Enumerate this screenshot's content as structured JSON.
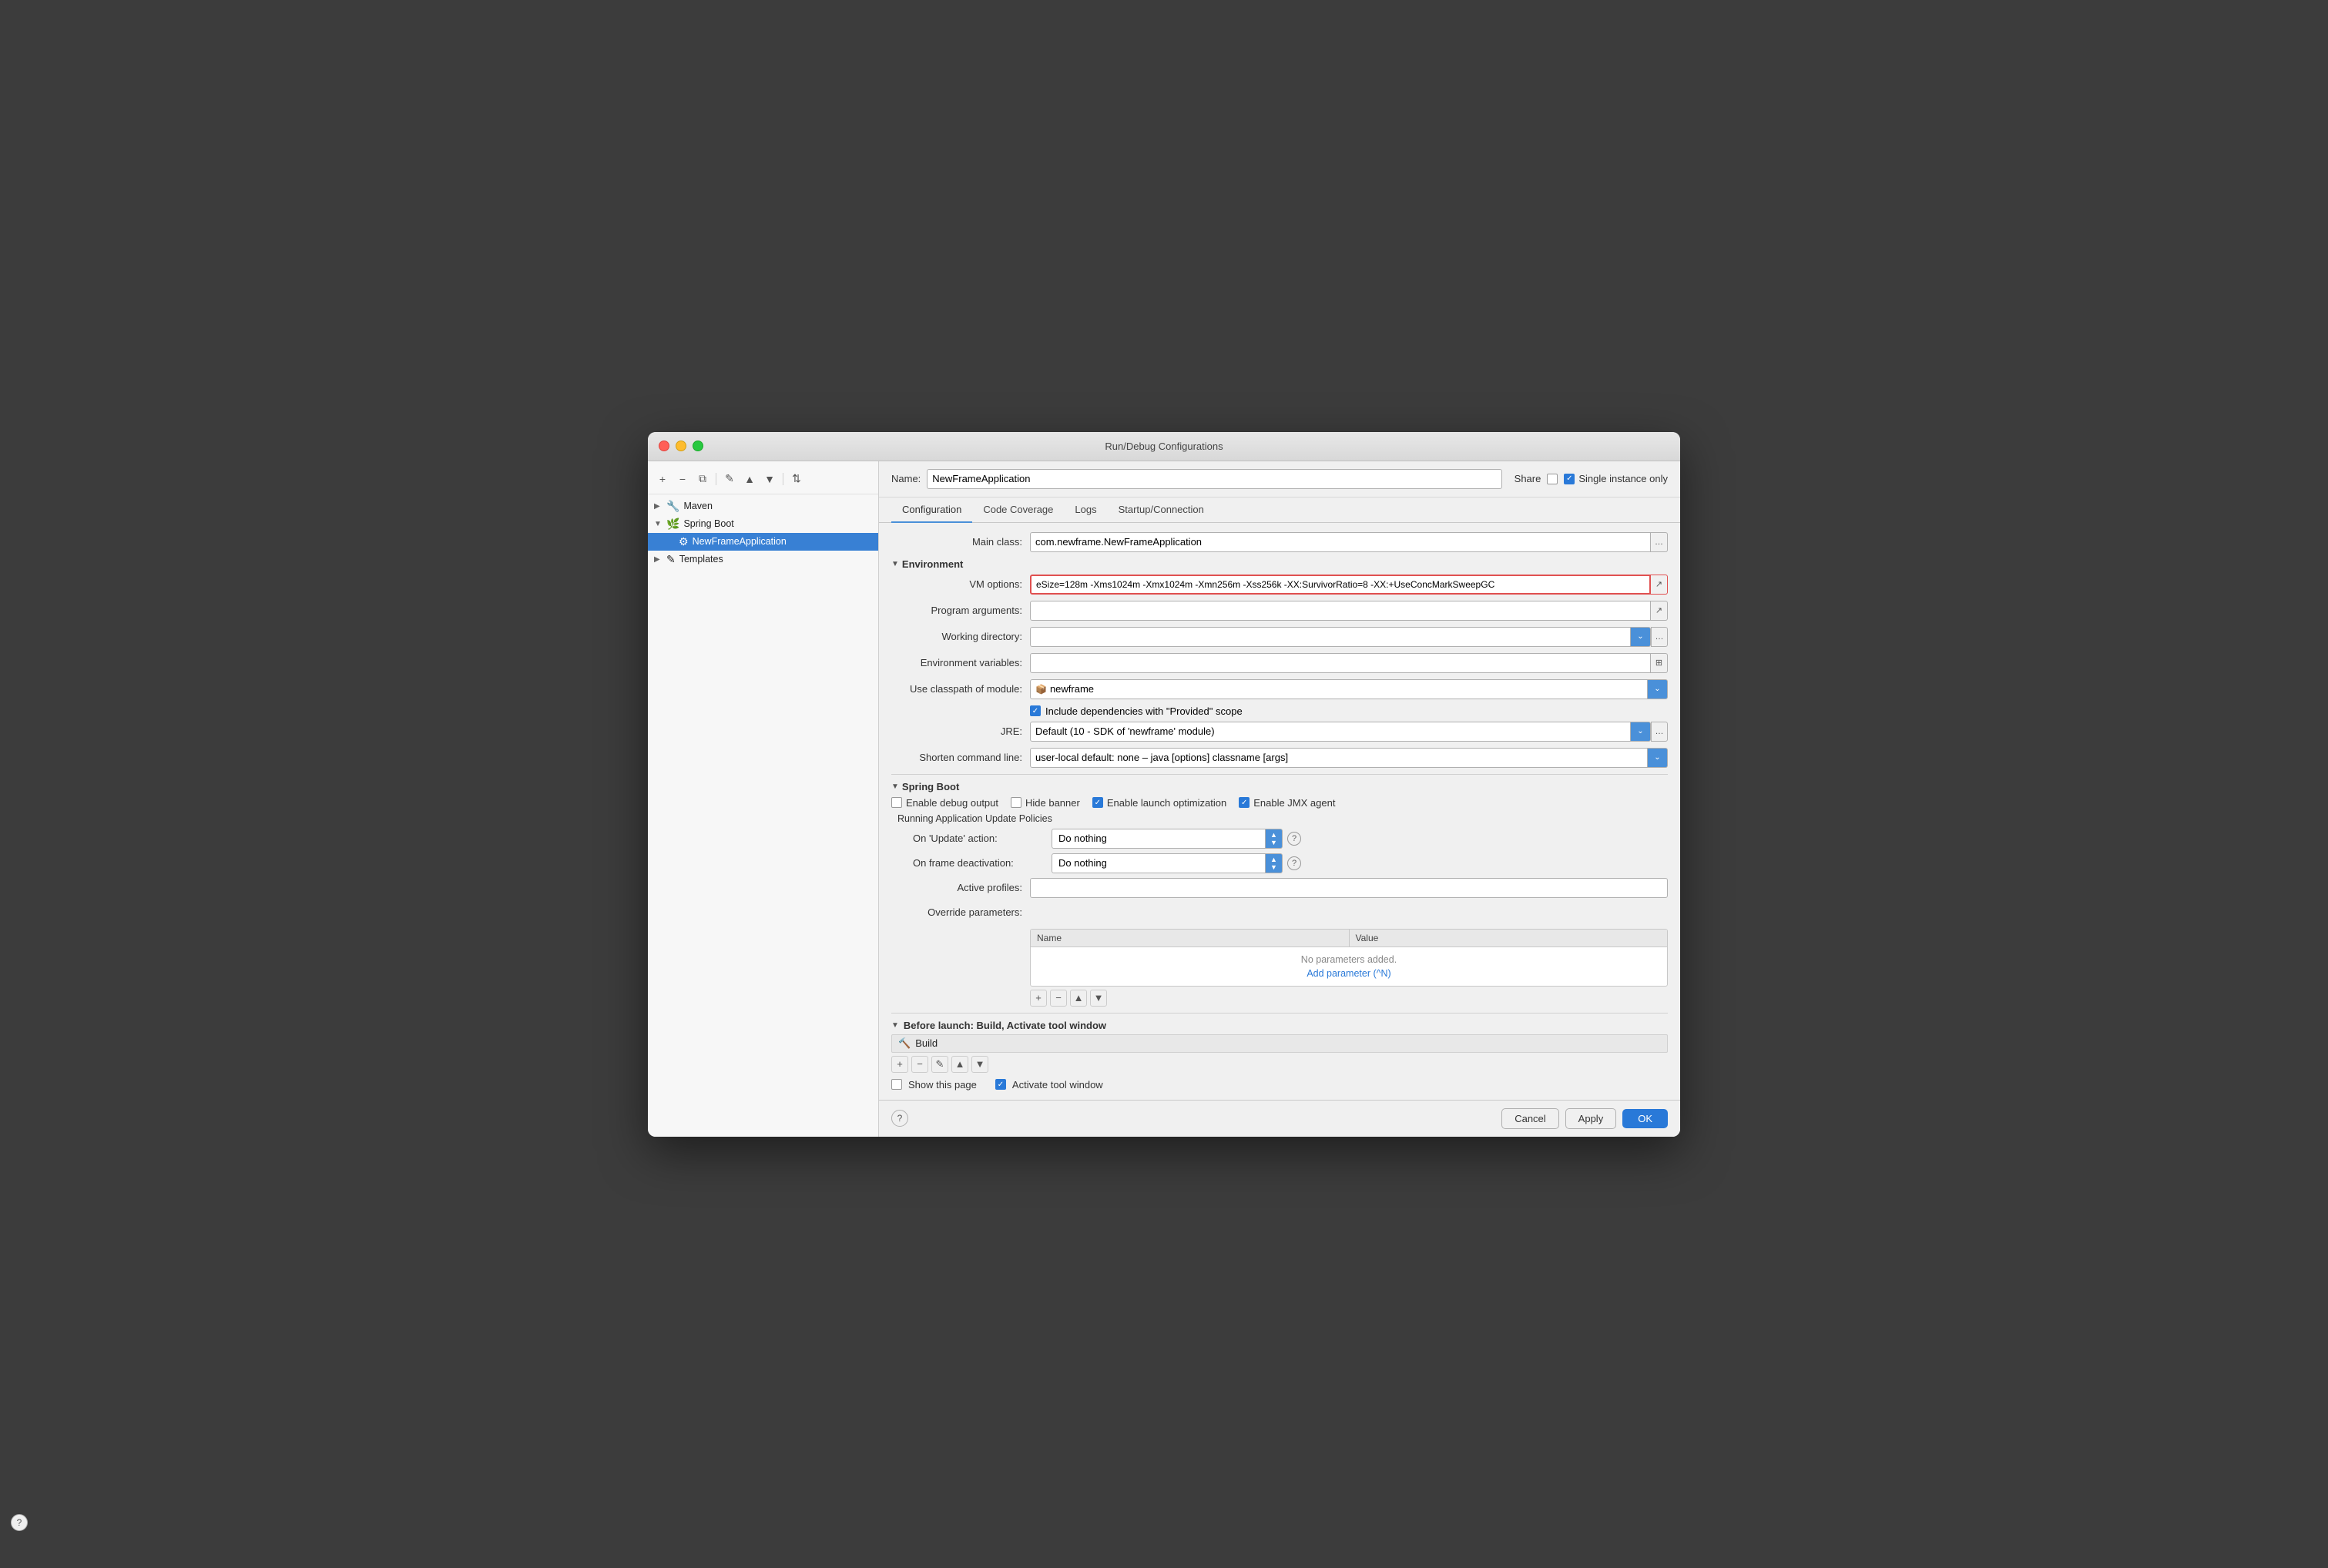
{
  "window": {
    "title": "Run/Debug Configurations"
  },
  "sidebar": {
    "toolbar": {
      "add": "+",
      "remove": "−",
      "copy": "⧉",
      "edit": "✎",
      "up": "▲",
      "down": "▼",
      "sort": "⇅"
    },
    "items": [
      {
        "id": "maven",
        "label": "Maven",
        "indent": 0,
        "hasArrow": true,
        "icon": "🔧",
        "selected": false
      },
      {
        "id": "spring-boot",
        "label": "Spring Boot",
        "indent": 0,
        "hasArrow": true,
        "icon": "🌿",
        "selected": false
      },
      {
        "id": "newframe",
        "label": "NewFrameApplication",
        "indent": 1,
        "hasArrow": false,
        "icon": "",
        "selected": true
      },
      {
        "id": "templates",
        "label": "Templates",
        "indent": 0,
        "hasArrow": true,
        "icon": "✎",
        "selected": false
      }
    ],
    "help_label": "?"
  },
  "name_row": {
    "label": "Name:",
    "value": "NewFrameApplication",
    "share_label": "Share",
    "single_instance_label": "Single instance only"
  },
  "tabs": {
    "items": [
      {
        "id": "configuration",
        "label": "Configuration",
        "active": true
      },
      {
        "id": "code-coverage",
        "label": "Code Coverage",
        "active": false
      },
      {
        "id": "logs",
        "label": "Logs",
        "active": false
      },
      {
        "id": "startup-connection",
        "label": "Startup/Connection",
        "active": false
      }
    ]
  },
  "form": {
    "main_class_label": "Main class:",
    "main_class_value": "com.newframe.NewFrameApplication",
    "environment_header": "Environment",
    "vm_options_label": "VM options:",
    "vm_options_value": "eSize=128m -Xms1024m -Xmx1024m -Xmn256m -Xss256k -XX:SurvivorRatio=8 -XX:+UseConcMarkSweepGC",
    "program_args_label": "Program arguments:",
    "program_args_value": "",
    "working_dir_label": "Working directory:",
    "working_dir_value": "",
    "env_vars_label": "Environment variables:",
    "env_vars_value": "",
    "use_classpath_label": "Use classpath of module:",
    "module_value": "newframe",
    "module_icon": "📦",
    "include_deps_label": "Include dependencies with \"Provided\" scope",
    "jre_label": "JRE:",
    "jre_value": "Default (10 - SDK of 'newframe' module)",
    "shorten_cmd_label": "Shorten command line:",
    "shorten_cmd_value": "user-local default: none – java [options] classname [args]",
    "spring_boot_header": "Spring Boot",
    "enable_debug_label": "Enable debug output",
    "hide_banner_label": "Hide banner",
    "enable_launch_label": "Enable launch optimization",
    "enable_jmx_label": "Enable JMX agent",
    "running_update_label": "Running Application Update Policies",
    "on_update_label": "On 'Update' action:",
    "on_update_value": "Do nothing",
    "on_frame_label": "On frame deactivation:",
    "on_frame_value": "Do nothing",
    "active_profiles_label": "Active profiles:",
    "active_profiles_value": "",
    "override_params_label": "Override parameters:",
    "params_name_header": "Name",
    "params_value_header": "Value",
    "no_params_text": "No parameters added.",
    "add_param_text": "Add parameter (^N)",
    "before_launch_header": "Before launch: Build, Activate tool window",
    "build_label": "Build",
    "show_page_label": "Show this page",
    "activate_window_label": "Activate tool window"
  },
  "bottom": {
    "cancel_label": "Cancel",
    "apply_label": "Apply",
    "ok_label": "OK"
  }
}
